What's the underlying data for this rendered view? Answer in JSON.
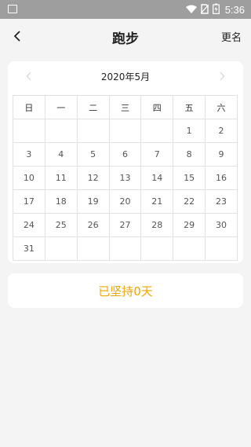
{
  "status_bar": {
    "time": "5:36",
    "icons": [
      "image-icon",
      "wifi-icon",
      "no-sim-icon",
      "battery-charging-icon"
    ]
  },
  "header": {
    "title": "跑步",
    "right_action": "更名",
    "back_icon": "chevron-left-icon"
  },
  "calendar": {
    "month_label": "2020年5月",
    "prev_icon": "chevron-left-icon",
    "next_icon": "chevron-right-icon",
    "weekdays": [
      "日",
      "一",
      "二",
      "三",
      "四",
      "五",
      "六"
    ],
    "weeks": [
      [
        "",
        "",
        "",
        "",
        "",
        "1",
        "2"
      ],
      [
        "3",
        "4",
        "5",
        "6",
        "7",
        "8",
        "9"
      ],
      [
        "10",
        "11",
        "12",
        "13",
        "14",
        "15",
        "16"
      ],
      [
        "17",
        "18",
        "19",
        "20",
        "21",
        "22",
        "23"
      ],
      [
        "24",
        "25",
        "26",
        "27",
        "28",
        "29",
        "30"
      ],
      [
        "31",
        "",
        "",
        "",
        "",
        "",
        ""
      ]
    ]
  },
  "streak": {
    "text": "已坚持0天",
    "color": "#f0a500"
  }
}
